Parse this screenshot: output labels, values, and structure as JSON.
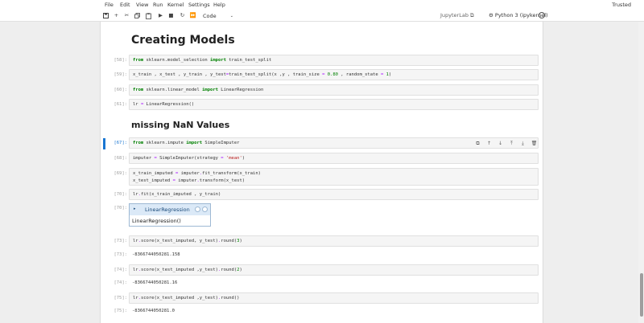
{
  "menu": {
    "items": [
      "File",
      "Edit",
      "View",
      "Run",
      "Kernel",
      "Settings",
      "Help"
    ],
    "trusted": "Trusted"
  },
  "toolbar": {
    "cell_type": "Code",
    "lab_link": "JupyterLab",
    "kernel": "Python 3 (ipykernel)"
  },
  "headings": {
    "creating_models": "Creating Models",
    "missing_values": "missing NaN Values"
  },
  "prompts": {
    "p58": "[58]:",
    "p59": "[59]:",
    "p60": "[60]:",
    "p61": "[61]:",
    "p67": "[67]:",
    "p68": "[68]:",
    "p69": "[69]:",
    "p70": "[70]:",
    "p70o": "[70]:",
    "p73": "[73]:",
    "p73o": "[73]:",
    "p74": "[74]:",
    "p74o": "[74]:",
    "p75": "[75]:",
    "p75o": "[75]:"
  },
  "code": {
    "c58": {
      "a": "from",
      "b": " sklearn.model_selection ",
      "c": "import",
      "d": " train_test_split"
    },
    "c59": {
      "a": "x_train , x_test , y_train , y_test",
      "b": "=",
      "c": "train_test_split(x ,y , train_size ",
      "d": "=",
      "e": " ",
      "f": "0.80",
      "g": " , random_state ",
      "h": "=",
      "i": " ",
      "j": "1",
      "k": ")"
    },
    "c60": {
      "a": "from",
      "b": " sklearn.linear_model ",
      "c": "import",
      "d": " LinearRegression"
    },
    "c61": {
      "a": "lr ",
      "b": "=",
      "c": " LinearRegression()"
    },
    "c67": {
      "a": "from",
      "b": " sklearn.impute ",
      "c": "import",
      "d": " SimpleImputer"
    },
    "c68": {
      "a": "imputer ",
      "b": "=",
      "c": " SimpleImputer(strategy ",
      "d": "=",
      "e": " ",
      "f": "'mean'",
      "g": ")"
    },
    "c69": {
      "l1a": "x_train_imputed ",
      "l1b": "=",
      "l1c": " imputer",
      "l1d": ".",
      "l1e": "fit_transform(x_train)",
      "l2a": "x_test_imputed ",
      "l2b": "=",
      "l2c": " imputer",
      "l2d": ".",
      "l2e": "transform(x_test)"
    },
    "c70": {
      "a": "lr",
      "b": ".",
      "c": "fit(x_train_imputed , y_train)"
    },
    "c73": {
      "a": "lr",
      "b": ".",
      "c": "score(x_test_imputed, y_test)",
      "d": ".",
      "e": "round(",
      "f": "3",
      "g": ")"
    },
    "c74": {
      "a": "lr",
      "b": ".",
      "c": "score(x_test_imputed ,y_test)",
      "d": ".",
      "e": "round(",
      "f": "2",
      "g": ")"
    },
    "c75": {
      "a": "lr",
      "b": ".",
      "c": "score(x_test_imputed ,y_test)",
      "d": ".",
      "e": "round()"
    }
  },
  "outputs": {
    "o73": "-8366744050281.158",
    "o74": "-8366744050281.16",
    "o75": "-8366744050281.0"
  },
  "repr": {
    "title": "LinearRegression",
    "body": "LinearRegression()"
  },
  "colors": {
    "accent": "#1976d2",
    "keyword": "#008000",
    "operator": "#aa22ff",
    "string": "#ba2121"
  }
}
